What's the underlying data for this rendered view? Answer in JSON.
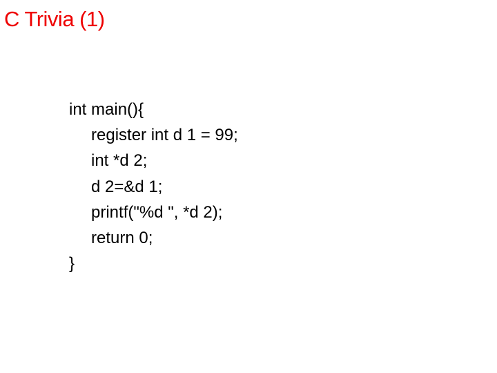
{
  "slide": {
    "title": "C Trivia (1)"
  },
  "code": {
    "line1": "int main(){",
    "line2": "register int d 1 = 99;",
    "line3": "int *d 2;",
    "line4": "d 2=&d 1;",
    "line5": "printf(\"%d \", *d 2);",
    "line6": "return 0;",
    "line7": "}"
  }
}
